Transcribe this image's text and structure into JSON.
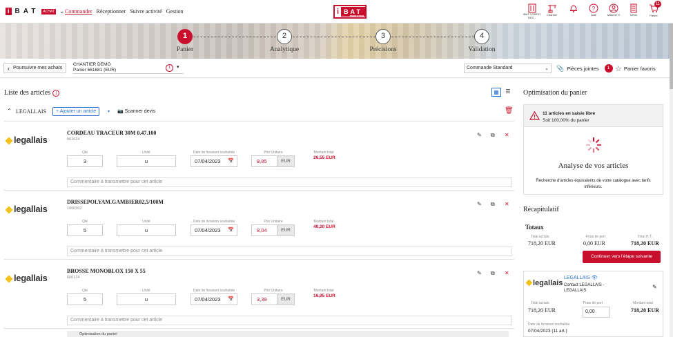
{
  "brand": {
    "letter": "i",
    "name": "BAT",
    "tag": "ACHAT"
  },
  "nav": {
    "items": [
      "Commander",
      "Réceptionner",
      "Suivre activité",
      "Gestion"
    ],
    "active": 0
  },
  "center_logo": {
    "left": "i",
    "right": "BAT",
    "sub": "PRODUCTION"
  },
  "top_icons": [
    {
      "name": "config",
      "label": "IBAT CONFIG\nDEV -"
    },
    {
      "name": "chantier",
      "label": "Chantier"
    },
    {
      "name": "notifications",
      "label": ""
    },
    {
      "name": "aide",
      "label": "Aide"
    },
    {
      "name": "user",
      "label": "Maxime G"
    },
    {
      "name": "devis",
      "label": "Devis"
    },
    {
      "name": "panier",
      "label": "Panier",
      "badge": "11"
    }
  ],
  "steps": [
    {
      "num": "1",
      "label": "Panier",
      "active": true
    },
    {
      "num": "2",
      "label": "Analytique",
      "active": false
    },
    {
      "num": "3",
      "label": "Précisions",
      "active": false
    },
    {
      "num": "4",
      "label": "Validation",
      "active": false
    }
  ],
  "toolbar": {
    "back_label": "Poursuivre mes achats",
    "project": "CHANTIER DEMO",
    "cart": "Panier 661681 (EUR)",
    "cart_count": "1",
    "order_type": "Commande Standard",
    "attachments_label": "Pièces jointes",
    "attachments_count": "1",
    "favorite_label": "Panier favoris"
  },
  "list": {
    "title": "Liste des articles",
    "supplier": "LEGALLAIS",
    "add_label": "+ Ajouter un article",
    "scan_label": "Scanner devis",
    "field_labels": {
      "qty": "Qté",
      "unit": "Unité",
      "date": "Date de livraison souhaitée",
      "price": "Prix Unitaire",
      "total": "Montant total"
    },
    "comment_placeholder": "Commentaire à transmettre pour cet article",
    "footer": "Optimisation du panier"
  },
  "articles": [
    {
      "logo": "legallais",
      "name": "CORDEAU TRACEUR 30M 0.47.100",
      "ref": "561624",
      "qty": "3",
      "unit": "u",
      "date": "07/04/2023",
      "price": "8,85",
      "currency": "EUR",
      "total": "26,55 EUR"
    },
    {
      "logo": "legallais",
      "name": "DRISSEPOLYAM.GAMBIER02,5/100M",
      "ref": "1060502",
      "qty": "5",
      "unit": "u",
      "date": "07/04/2023",
      "price": "8,04",
      "currency": "EUR",
      "total": "40,20 EUR"
    },
    {
      "logo": "legallais",
      "name": "BROSSE MONOBLOX 150 X 55",
      "ref": "606124",
      "qty": "5",
      "unit": "u",
      "date": "07/04/2023",
      "price": "3,39",
      "currency": "EUR",
      "total": "16,95 EUR"
    }
  ],
  "optimisation": {
    "title": "Optimisation du panier",
    "warn_title": "11 articles en saisie libre",
    "warn_sub": "Soit 100,00% du panier",
    "analyse_title": "Analyse de vos articles",
    "analyse_text": "Recherche d'articles équivalents de votre catalogue avec tarifs inférieurs."
  },
  "recap": {
    "title": "Récapitulatif",
    "totaux": "Totaux",
    "total_achats_label": "Total achats",
    "total_achats": "718,20 EUR",
    "frais_label": "Frais de port",
    "frais": "0,00 EUR",
    "total_ht_label": "Total H.T.",
    "total_ht": "718,20 EUR",
    "next_button": "Continuer vers l'étape suivante"
  },
  "supplier_card": {
    "logo": "legallais",
    "name": "LEGALLAIS",
    "contact": "Contact LEGALLAIS - LEGALLAIS",
    "total_achats_label": "Total achats",
    "total_achats": "718,20 EUR",
    "frais_label": "Frais de port",
    "frais": "0,00",
    "montant_label": "Montant total",
    "montant": "718,20 EUR",
    "date_label": "Date de livraison souhaitée",
    "date": "07/04/2023 (11 art.)"
  },
  "colors": {
    "accent": "#c8102e",
    "link": "#2a6fd0",
    "logo_yellow": "#f2c21a"
  }
}
